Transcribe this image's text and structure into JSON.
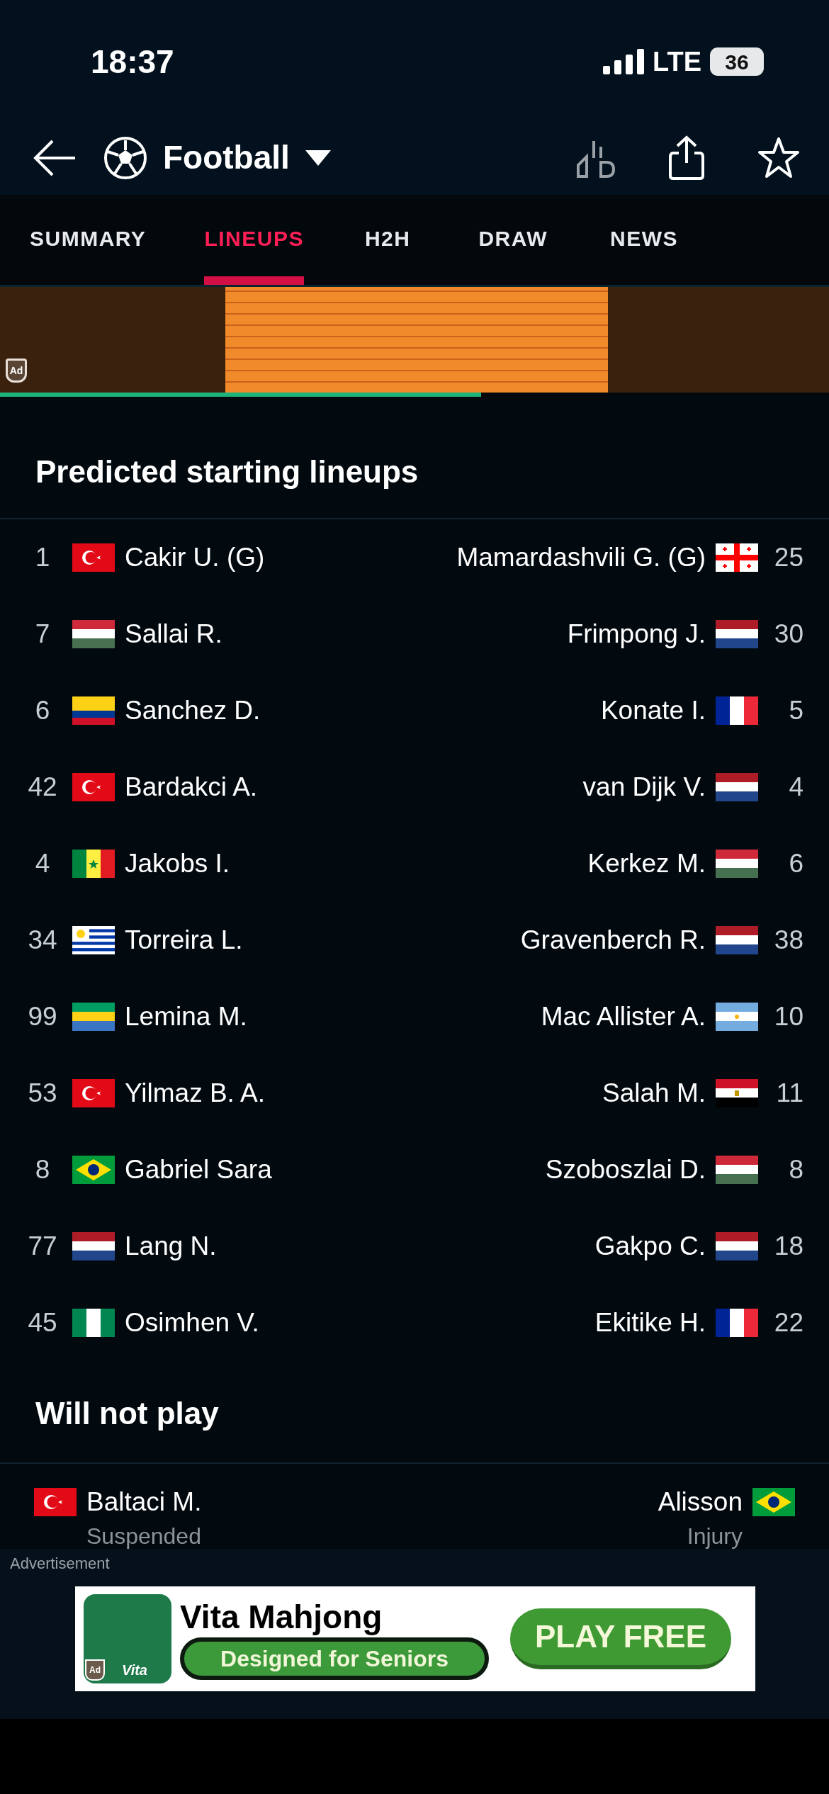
{
  "status_bar": {
    "time": "18:37",
    "network": "LTE",
    "battery": "36"
  },
  "header": {
    "sport": "Football"
  },
  "tabs": [
    {
      "label": "SUMMARY",
      "selected": false
    },
    {
      "label": "LINEUPS",
      "selected": true
    },
    {
      "label": "H2H",
      "selected": false
    },
    {
      "label": "DRAW",
      "selected": false
    },
    {
      "label": "NEWS",
      "selected": false
    }
  ],
  "top_ad": {
    "badge": "Ad",
    "level": 0.58
  },
  "lineups": {
    "title": "Predicted starting lineups",
    "rows": [
      {
        "home": {
          "number": "1",
          "name": "Cakir U. (G)",
          "kind": "tr"
        },
        "away": {
          "number": "25",
          "name": "Mamardashvili G. (G)",
          "kind": "ge"
        }
      },
      {
        "home": {
          "number": "7",
          "name": "Sallai R.",
          "kind": "hu"
        },
        "away": {
          "number": "30",
          "name": "Frimpong J.",
          "kind": "nl"
        }
      },
      {
        "home": {
          "number": "6",
          "name": "Sanchez D.",
          "kind": "co"
        },
        "away": {
          "number": "5",
          "name": "Konate I.",
          "kind": "fr"
        }
      },
      {
        "home": {
          "number": "42",
          "name": "Bardakci A.",
          "kind": "tr"
        },
        "away": {
          "number": "4",
          "name": "van Dijk V.",
          "kind": "nl"
        }
      },
      {
        "home": {
          "number": "4",
          "name": "Jakobs I.",
          "kind": "sn"
        },
        "away": {
          "number": "6",
          "name": "Kerkez M.",
          "kind": "hu"
        }
      },
      {
        "home": {
          "number": "34",
          "name": "Torreira L.",
          "kind": "uy"
        },
        "away": {
          "number": "38",
          "name": "Gravenberch R.",
          "kind": "nl"
        }
      },
      {
        "home": {
          "number": "99",
          "name": "Lemina M.",
          "kind": "ga"
        },
        "away": {
          "number": "10",
          "name": "Mac Allister A.",
          "kind": "ar"
        }
      },
      {
        "home": {
          "number": "53",
          "name": "Yilmaz B. A.",
          "kind": "tr"
        },
        "away": {
          "number": "11",
          "name": "Salah M.",
          "kind": "eg"
        }
      },
      {
        "home": {
          "number": "8",
          "name": "Gabriel Sara",
          "kind": "br"
        },
        "away": {
          "number": "8",
          "name": "Szoboszlai D.",
          "kind": "hu"
        }
      },
      {
        "home": {
          "number": "77",
          "name": "Lang N.",
          "kind": "nl"
        },
        "away": {
          "number": "18",
          "name": "Gakpo C.",
          "kind": "nl"
        }
      },
      {
        "home": {
          "number": "45",
          "name": "Osimhen V.",
          "kind": "ng"
        },
        "away": {
          "number": "22",
          "name": "Ekitike H.",
          "kind": "fr"
        }
      }
    ]
  },
  "will_not_play": {
    "title": "Will not play",
    "rows": [
      {
        "home": {
          "name": "Baltaci M.",
          "reason": "Suspended",
          "kind": "tr"
        },
        "away": {
          "name": "Alisson",
          "reason": "Injury",
          "kind": "br"
        }
      }
    ]
  },
  "bottom_ad": {
    "label": "Advertisement",
    "badge": "Ad",
    "app_label": "Vita",
    "title": "Vita Mahjong",
    "subtitle": "Designed for Seniors",
    "button": "PLAY FREE"
  }
}
